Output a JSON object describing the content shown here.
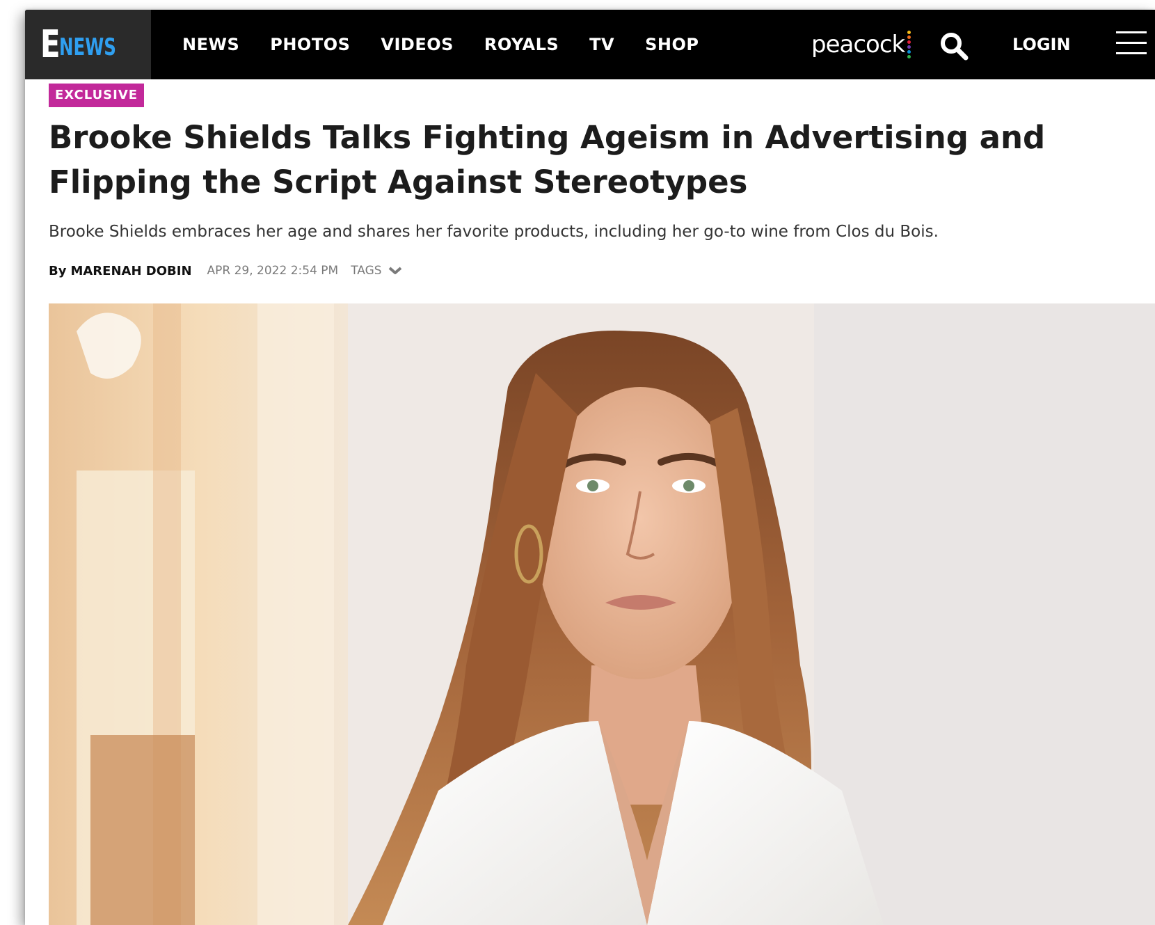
{
  "nav": {
    "logo": {
      "e": "E",
      "news": "NEWS"
    },
    "links": [
      "NEWS",
      "PHOTOS",
      "VIDEOS",
      "ROYALS",
      "TV",
      "SHOP"
    ],
    "partner": "peacock",
    "partner_dot_colors": [
      "#f6bd18",
      "#f26b1d",
      "#e41e3a",
      "#6d3cb3",
      "#0a8fd8",
      "#2fb34a"
    ],
    "search_icon": "search-icon",
    "login_label": "LOGIN",
    "menu_icon": "hamburger-menu-icon"
  },
  "article": {
    "badge": "EXCLUSIVE",
    "badge_color": "#c2299a",
    "headline": "Brooke Shields Talks Fighting Ageism in Advertising and Flipping the Script Against Stereotypes",
    "dek": "Brooke Shields embraces her age and shares her favorite products, including her go-to wine from Clos du Bois.",
    "byline": {
      "by": "By",
      "author": "MARENAH DOBIN",
      "date": "APR 29, 2022 2:54 PM",
      "tags_label": "TAGS"
    }
  },
  "colors": {
    "nav_bg": "#000000",
    "logo_bg": "#2a2a2a",
    "logo_news": "#2f9ff0",
    "headline": "#1c1c1c",
    "meta_gray": "#7a7a7a"
  }
}
